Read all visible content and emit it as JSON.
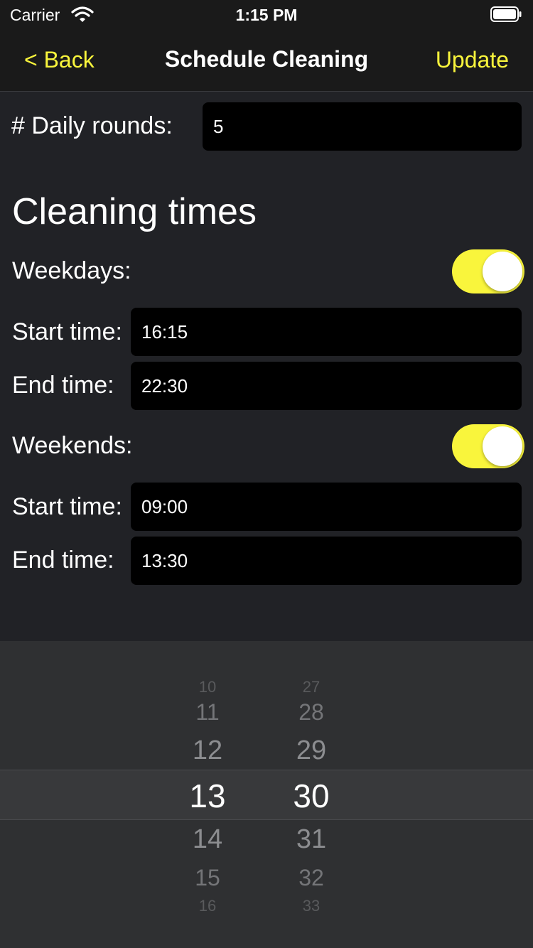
{
  "status": {
    "carrier": "Carrier",
    "time": "1:15 PM"
  },
  "nav": {
    "back": "< Back",
    "title": "Schedule Cleaning",
    "action": "Update"
  },
  "daily_rounds": {
    "label": "# Daily rounds:",
    "value": "5"
  },
  "section_title": "Cleaning times",
  "weekdays": {
    "label": "Weekdays:",
    "enabled": true,
    "start_label": "Start time:",
    "start": "16:15",
    "end_label": "End time:",
    "end": "22:30"
  },
  "weekends": {
    "label": "Weekends:",
    "enabled": true,
    "start_label": "Start time:",
    "start": "09:00",
    "end_label": "End time:",
    "end": "13:30"
  },
  "picker": {
    "hours": [
      "10",
      "11",
      "12",
      "13",
      "14",
      "15",
      "16"
    ],
    "minutes": [
      "27",
      "28",
      "29",
      "30",
      "31",
      "32",
      "33"
    ],
    "selected_hour": "13",
    "selected_minute": "30"
  },
  "colors": {
    "accent": "#f9f53c",
    "background": "#212226",
    "field": "#000000"
  }
}
